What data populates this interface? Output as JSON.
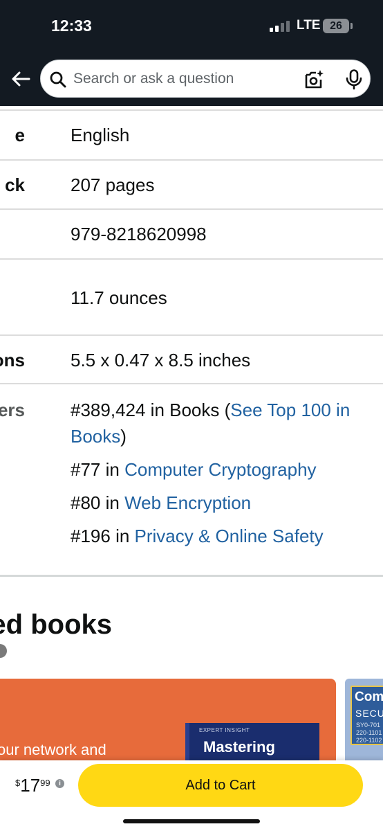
{
  "status_bar": {
    "time": "12:33",
    "network": "LTE",
    "battery": "26"
  },
  "search": {
    "placeholder": "Search or ask a question"
  },
  "details": [
    {
      "key": "e",
      "value": "English"
    },
    {
      "key": "ck",
      "value": "207 pages"
    },
    {
      "key": "",
      "value": "979-8218620998"
    },
    {
      "key": "",
      "value": "11.7 ounces"
    },
    {
      "key": "ons",
      "value": "5.5 x 0.47 x 8.5 inches"
    }
  ],
  "best_sellers": {
    "key": "ers",
    "main_prefix": "#389,424 in Books (",
    "main_link": "See Top 100 in",
    "main_link_2": "Books",
    "main_suffix": ")",
    "ranks": [
      {
        "prefix": "#77 in ",
        "category": "Computer Cryptography"
      },
      {
        "prefix": "#80 in ",
        "category": "Web Encryption"
      },
      {
        "prefix": "#196 in ",
        "category": "Privacy & Online Safety"
      }
    ]
  },
  "related": {
    "title": "ed books",
    "banner_text": "our network and",
    "book_small": "EXPERT INSIGHT",
    "book_title": "Mastering",
    "card2_title": "Com",
    "card2_sub": "SECU",
    "card2_codes": [
      "SY0-701",
      "220-1101",
      "220-1102"
    ]
  },
  "buy_bar": {
    "currency": "$",
    "price_whole": "17",
    "price_fraction": "99",
    "add_to_cart": "Add to Cart"
  },
  "colors": {
    "header": "#131a22",
    "link": "#2162a1",
    "cart_button": "#ffd814",
    "banner": "#e76b3b"
  }
}
